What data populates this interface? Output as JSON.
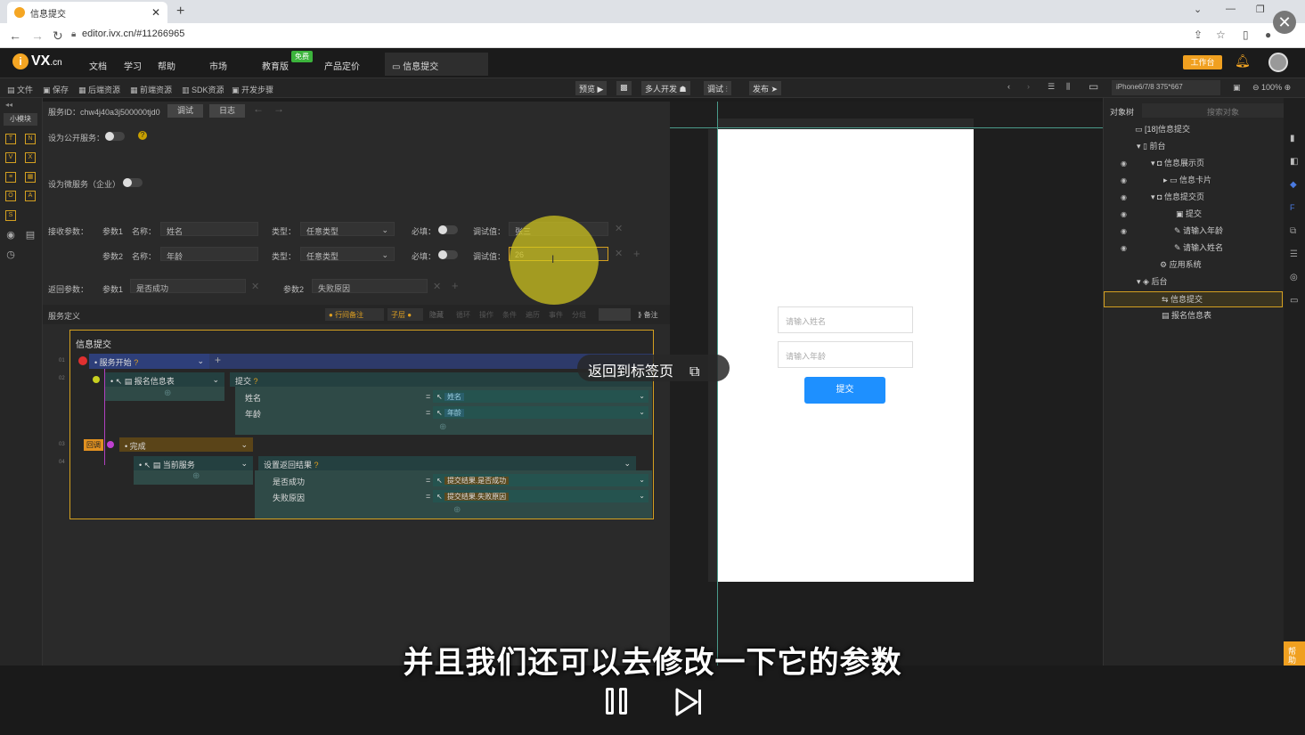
{
  "browser": {
    "tab_title": "信息提交",
    "url": "editor.ivx.cn/#11266965"
  },
  "app": {
    "logo": "VX",
    "logo_domain": ".cn",
    "menu": [
      "文档",
      "学习",
      "帮助",
      "市场",
      "教育版",
      "产品定价"
    ],
    "free_badge": "免费",
    "active_tab": "信息提交",
    "work_button": "工作台"
  },
  "toolbar": {
    "left": [
      "文件",
      "保存",
      "后端资源",
      "前端资源",
      "SDK资源",
      "开发步骤"
    ],
    "preview": "预览",
    "multi_dev": "多人开发",
    "debug": "调试",
    "publish": "发布",
    "device": "iPhone6/7/8 375*667",
    "zoom": "100%"
  },
  "left_sidebar": {
    "small_module": "小模块"
  },
  "service": {
    "id_label": "服务ID：chw4j40a3j500000tjd0",
    "debug_btn": "调试",
    "log_btn": "日志",
    "public_label": "设为公开服务：",
    "micro_label": "设为微服务（企业）",
    "recv_label": "接收参数：",
    "params": [
      {
        "idx": "参数1",
        "name_label": "名称：",
        "name": "姓名",
        "type_label": "类型：",
        "type": "任意类型",
        "req_label": "必填：",
        "debug_label": "调试值：",
        "debug": "张三"
      },
      {
        "idx": "参数2",
        "name_label": "名称：",
        "name": "年龄",
        "type_label": "类型：",
        "type": "任意类型",
        "req_label": "必填：",
        "debug_label": "调试值：",
        "debug": "26"
      }
    ],
    "return_label": "返回参数：",
    "returns": [
      {
        "idx": "参数1",
        "value": "是否成功"
      },
      {
        "idx": "参数2",
        "value": "失败原因"
      }
    ],
    "def_label": "服务定义",
    "def_tools": [
      "行间备注",
      "子层",
      "隐藏",
      "循环",
      "操作",
      "条件",
      "遍历",
      "事件",
      "分组",
      "备注"
    ]
  },
  "flow": {
    "title": "信息提交",
    "start": "服务开始",
    "row_labels": [
      "01",
      "02",
      "03",
      "04"
    ],
    "action1": "报名信息表",
    "submit": "提交",
    "fields1": [
      {
        "k": "姓名",
        "v": "姓名"
      },
      {
        "k": "年龄",
        "v": "年龄"
      }
    ],
    "callback": "回调",
    "done": "完成",
    "action2": "当前服务",
    "set_result": "设置返回结果",
    "fields2": [
      {
        "k": "是否成功",
        "v": "提交结果.是否成功"
      },
      {
        "k": "失败原因",
        "v": "提交结果.失败原因"
      }
    ]
  },
  "preview": {
    "input1": "请输入姓名",
    "input2": "请输入年龄",
    "submit": "提交"
  },
  "object_tree": {
    "title": "对象树",
    "search": "搜索对象",
    "items": [
      "[18]信息提交",
      "前台",
      "信息展示页",
      "信息卡片",
      "信息提交页",
      "提交",
      "请输入年龄",
      "请输入姓名",
      "应用系统",
      "后台",
      "信息提交",
      "报名信息表"
    ]
  },
  "help_tab": "帮助",
  "overlay": {
    "back_to_tab": "返回到标签页",
    "subtitle": "并且我们还可以去修改一下它的参数"
  }
}
